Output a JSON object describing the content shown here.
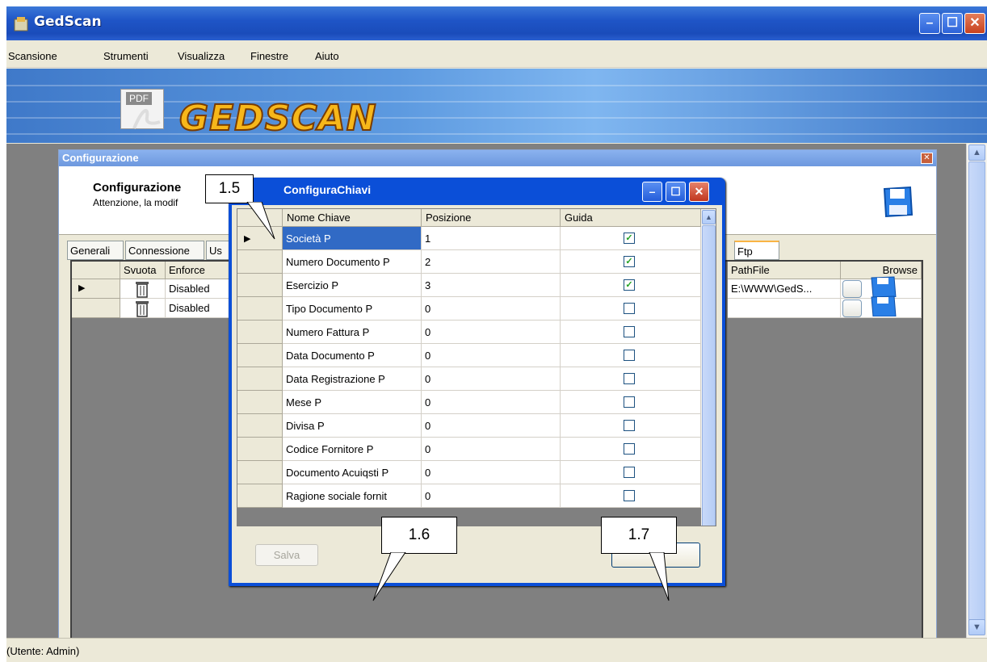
{
  "window": {
    "title": "GedScan"
  },
  "menu": [
    "Scansione",
    "Strumenti",
    "Visualizza",
    "Finestre",
    "Aiuto"
  ],
  "banner": {
    "pdf_label": "PDF",
    "logo_text": "GEDSCAN"
  },
  "config_window": {
    "title": "Configurazione",
    "header_title": "Configurazione",
    "header_subtitle": "Attenzione, la modif",
    "tabs": [
      "Generali",
      "Connessione",
      "Us",
      "Ftp"
    ],
    "grid_headers": {
      "svuota": "Svuota",
      "enforce": "Enforce",
      "pathfile": "PathFile",
      "browse": "Browse"
    },
    "rows": [
      {
        "enforce": "Disabled",
        "pathfile": "E:\\WWW\\GedS..."
      },
      {
        "enforce": "Disabled",
        "pathfile": ""
      }
    ]
  },
  "dialog": {
    "title": "ConfiguraChiavi",
    "headers": {
      "nome": "Nome Chiave",
      "posizione": "Posizione",
      "guida": "Guida"
    },
    "rows": [
      {
        "nome": "Società P",
        "posizione": "1",
        "guida": true
      },
      {
        "nome": "Numero Documento P",
        "posizione": "2",
        "guida": true
      },
      {
        "nome": "Esercizio P",
        "posizione": "3",
        "guida": true
      },
      {
        "nome": "Tipo Documento P",
        "posizione": "0",
        "guida": false
      },
      {
        "nome": "Numero Fattura P",
        "posizione": "0",
        "guida": false
      },
      {
        "nome": "Data Documento P",
        "posizione": "0",
        "guida": false
      },
      {
        "nome": "Data Registrazione P",
        "posizione": "0",
        "guida": false
      },
      {
        "nome": "Mese P",
        "posizione": "0",
        "guida": false
      },
      {
        "nome": "Divisa P",
        "posizione": "0",
        "guida": false
      },
      {
        "nome": "Codice Fornitore P",
        "posizione": "0",
        "guida": false
      },
      {
        "nome": "Documento Acuiqsti P",
        "posizione": "0",
        "guida": false
      },
      {
        "nome": "Ragione sociale fornit",
        "posizione": "0",
        "guida": false
      }
    ],
    "save_label": "Salva"
  },
  "callouts": [
    "1.5",
    "1.6",
    "1.7"
  ],
  "status": {
    "text": "(Utente: Admin)"
  },
  "colors": {
    "titlebar": "#1f55c7",
    "selection": "#316ac5",
    "workspace": "#808080"
  }
}
